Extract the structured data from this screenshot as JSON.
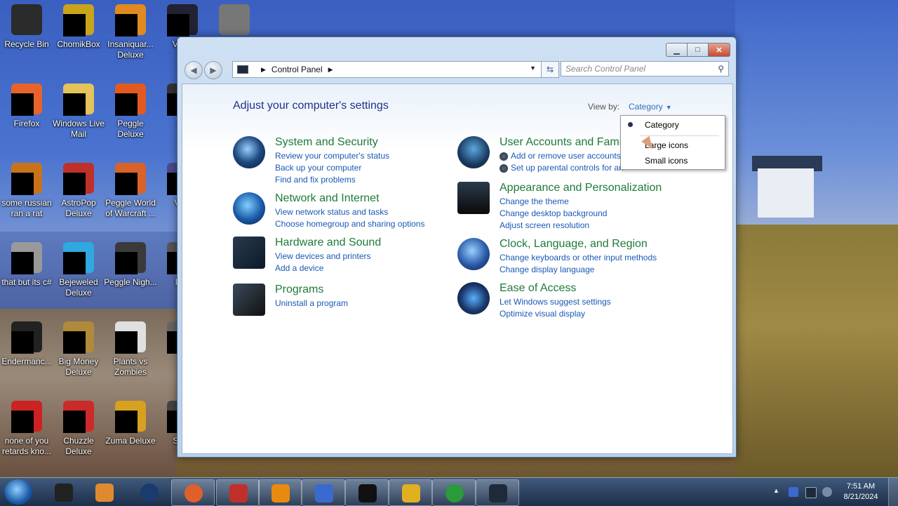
{
  "desktop": {
    "icons": [
      {
        "label": "Recycle Bin"
      },
      {
        "label": "ChomikBox"
      },
      {
        "label": "Insaniquar... Deluxe"
      },
      {
        "label": "Vi Ke"
      },
      {
        "label": ""
      },
      {
        "label": "Firefox"
      },
      {
        "label": "Windows Live Mail"
      },
      {
        "label": "Peggle Deluxe"
      },
      {
        "label": "Ke"
      },
      {
        "label": "some russian ran a rat"
      },
      {
        "label": "AstroPop Deluxe"
      },
      {
        "label": "Peggle World of Warcraft ..."
      },
      {
        "label": "Visu"
      },
      {
        "label": "that but its c#"
      },
      {
        "label": "Bejeweled Deluxe"
      },
      {
        "label": "Peggle Nigh..."
      },
      {
        "label": "Eve"
      },
      {
        "label": "Endermanc..."
      },
      {
        "label": "Big Money Deluxe"
      },
      {
        "label": "Plants vs Zombies"
      },
      {
        "label": "m"
      },
      {
        "label": "none of you retards kno..."
      },
      {
        "label": "Chuzzle Deluxe"
      },
      {
        "label": "Zuma Deluxe"
      },
      {
        "label": "Sanc"
      }
    ]
  },
  "window": {
    "caption": {
      "minimize": "▁",
      "maximize": "□",
      "close": "✕"
    },
    "address": {
      "path": "Control Panel"
    },
    "search": {
      "placeholder": "Search Control Panel"
    },
    "title": "Adjust your computer's settings",
    "view_by_label": "View by:",
    "view_by_value": "Category",
    "categories": [
      {
        "title": "System and Security",
        "links": [
          "Review your computer's status",
          "Back up your computer",
          "Find and fix problems"
        ]
      },
      {
        "title": "Network and Internet",
        "links": [
          "View network status and tasks",
          "Choose homegroup and sharing options"
        ]
      },
      {
        "title": "Hardware and Sound",
        "links": [
          "View devices and printers",
          "Add a device"
        ]
      },
      {
        "title": "Programs",
        "links": [
          "Uninstall a program"
        ]
      },
      {
        "title": "User Accounts and Family",
        "links": [
          "Add or remove user accounts",
          "Set up parental controls for an"
        ]
      },
      {
        "title": "Appearance and Personalization",
        "links": [
          "Change the theme",
          "Change desktop background",
          "Adjust screen resolution"
        ]
      },
      {
        "title": "Clock, Language, and Region",
        "links": [
          "Change keyboards or other input methods",
          "Change display language"
        ]
      },
      {
        "title": "Ease of Access",
        "links": [
          "Let Windows suggest settings",
          "Optimize visual display"
        ]
      }
    ],
    "dropdown": {
      "items": [
        "Category",
        "Large icons",
        "Small icons"
      ],
      "selected": "Category"
    }
  },
  "taskbar": {
    "clock_time": "7:51 AM",
    "clock_date": "8/21/2024",
    "tray_arrow": "▲"
  },
  "colors": {
    "link": "#1a59b5",
    "category_title": "#1e7a3a",
    "page_title": "#1e3287"
  }
}
